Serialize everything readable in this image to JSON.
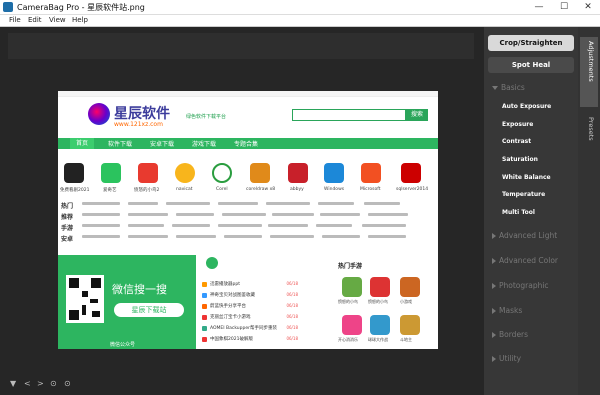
{
  "window": {
    "title": "CameraBag Pro - 星辰软件站.png",
    "minimize": "—",
    "maximize": "☐",
    "close": "✕"
  },
  "menu": [
    "File",
    "Edit",
    "View",
    "Help"
  ],
  "panel": {
    "crop_label": "Crop/Straighten",
    "spot_label": "Spot Heal",
    "basics_label": "Basics",
    "basics_items": [
      "Auto Exposure",
      "Exposure",
      "Contrast",
      "Saturation",
      "White Balance",
      "Temperature",
      "Multi Tool"
    ],
    "sections": [
      "Advanced Light",
      "Advanced Color",
      "Photographic",
      "Masks",
      "Borders",
      "Utility"
    ],
    "tabs": [
      "Adjustments",
      "Presets"
    ]
  },
  "bottom": {
    "icons": [
      "▼",
      "<",
      ">",
      "⊙",
      "⊙"
    ]
  },
  "photo": {
    "brand": "星辰软件",
    "url": "www.121xz.com",
    "slogan": "绿色软件下载平台",
    "search_btn": "搜索",
    "nav": [
      "首页",
      "软件下载",
      "安卓下载",
      "游戏下载",
      "专题合集"
    ],
    "apps": [
      "免费看剧2021",
      "爱奇艺",
      "愤怒的小鸟2",
      "navicat",
      "Corel",
      "coreldraw x8",
      "abbyy",
      "Windows",
      "Microsoft",
      "sqlserver2014"
    ],
    "row_labels": [
      "热门",
      "推荐",
      "手游",
      "安卓"
    ],
    "wechat_search": "微信搜一搜",
    "wechat_btn": "星辰下载站",
    "wechat_pub": "微信公众号",
    "hot_title": "热门手游",
    "list": [
      {
        "t": "迅雷播放器ppt",
        "n": "06/18"
      },
      {
        "t": "神奇宝贝对战图鉴收藏",
        "n": "06/18"
      },
      {
        "t": "蔚蓝快手分享平台",
        "n": "06/18"
      },
      {
        "t": "克丽丝汀宝卡小游戏",
        "n": "06/18"
      },
      {
        "t": "AOMEI Backupper帮手同步重装",
        "n": "06/18"
      },
      {
        "t": "中国象棋2021破解版",
        "n": "06/18"
      }
    ],
    "games": [
      "愤怒的小鸟",
      "愤怒的小鸟",
      "小游戏",
      "开心消消乐",
      "球球大作战",
      "斗地主"
    ]
  },
  "colors": {
    "accent": "#2db560",
    "panel": "#373737",
    "workspace": "#262626"
  }
}
